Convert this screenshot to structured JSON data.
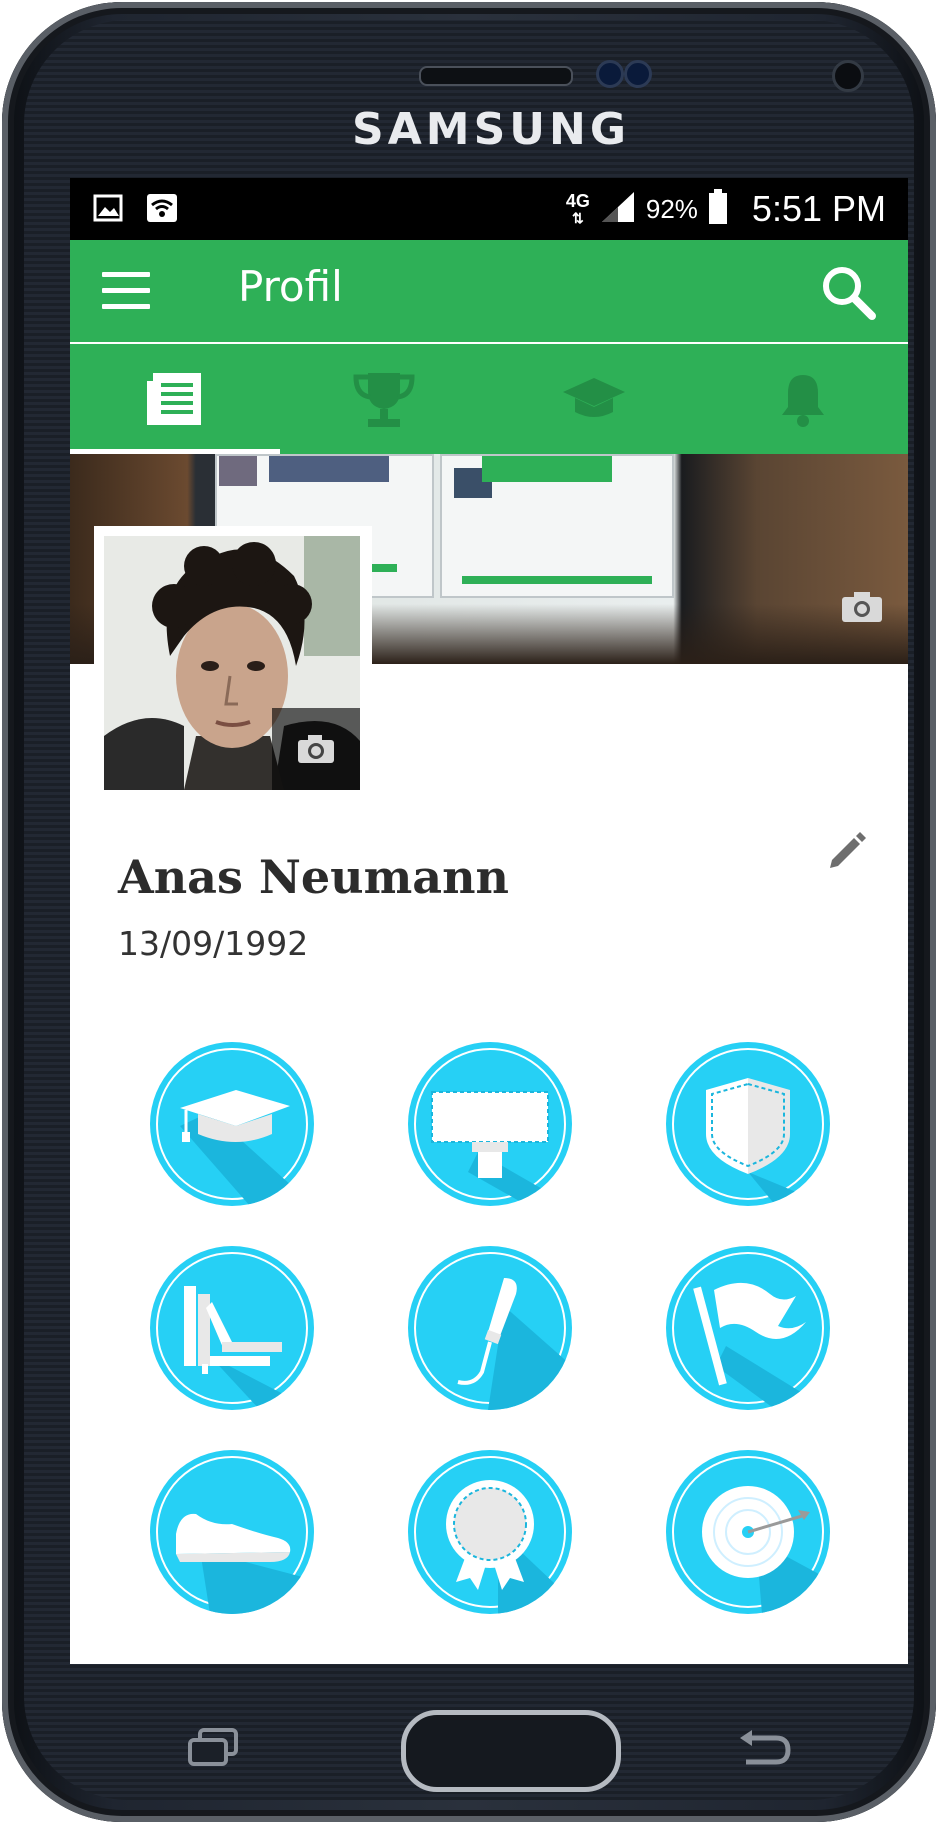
{
  "device": {
    "brand": "SAMSUNG"
  },
  "status_bar": {
    "network": "4G",
    "battery": "92%",
    "time": "5:51 PM"
  },
  "app_bar": {
    "title": "Profil"
  },
  "tabs": [
    {
      "icon": "news-icon",
      "active": true
    },
    {
      "icon": "trophy-icon",
      "active": false
    },
    {
      "icon": "graduation-cap-icon",
      "active": false
    },
    {
      "icon": "bell-icon",
      "active": false
    }
  ],
  "profile": {
    "name": "Anas Neumann",
    "birthdate": "13/09/1992"
  },
  "badges": [
    {
      "icon": "graduation-cap-badge"
    },
    {
      "icon": "billboard-badge"
    },
    {
      "icon": "shield-badge"
    },
    {
      "icon": "books-badge"
    },
    {
      "icon": "microphone-badge"
    },
    {
      "icon": "flag-badge"
    },
    {
      "icon": "sneaker-badge"
    },
    {
      "icon": "ribbon-badge"
    },
    {
      "icon": "target-badge"
    }
  ],
  "colors": {
    "accent": "#2eb057",
    "badge": "#26d0f5",
    "status_bar": "#000000"
  }
}
